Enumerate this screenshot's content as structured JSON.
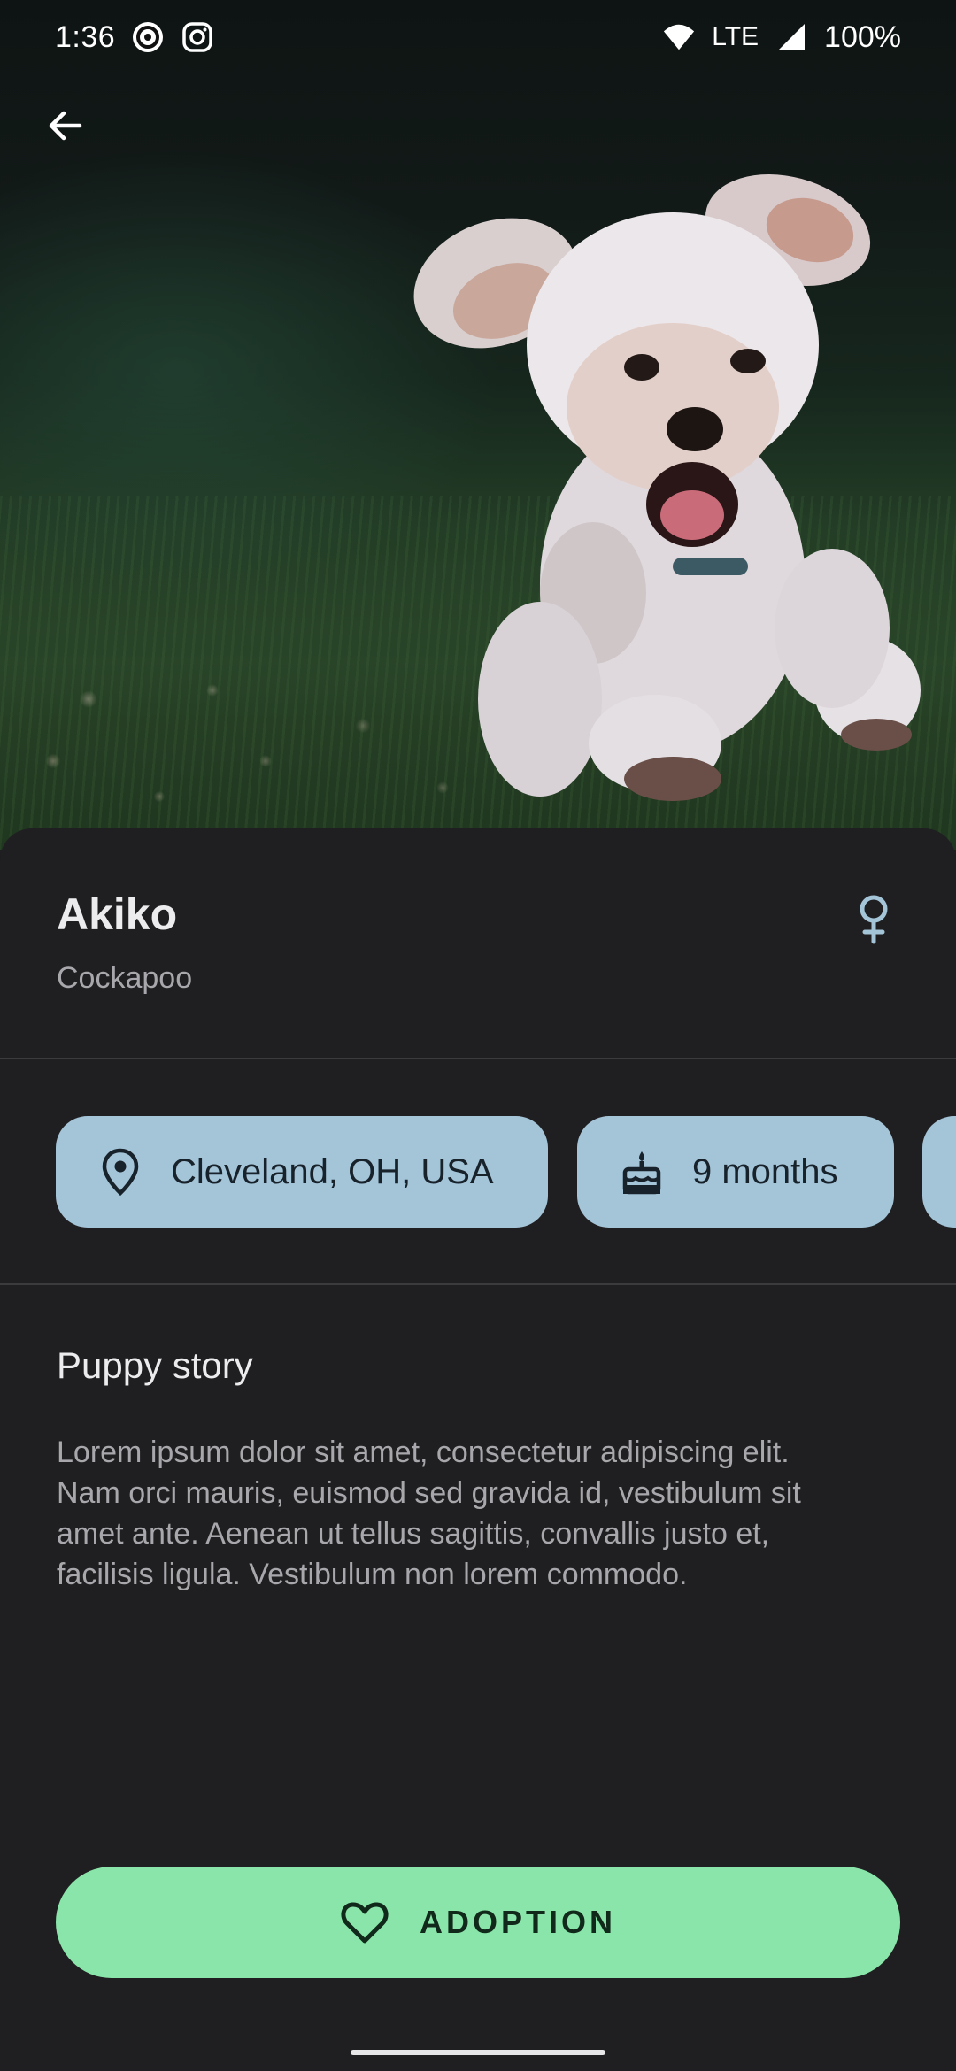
{
  "status_bar": {
    "time": "1:36",
    "network": "LTE",
    "battery": "100%",
    "icons": [
      "sync-circle-icon",
      "instagram-icon",
      "wifi-icon",
      "signal-icon"
    ]
  },
  "hero": {
    "back_icon": "arrow-left-icon",
    "photo": "white-fluffy-dog-running-on-grass"
  },
  "pet": {
    "name": "Akiko",
    "breed": "Cockapoo",
    "gender_icon": "female-icon"
  },
  "chips": [
    {
      "icon": "location-pin-icon",
      "label": "Cleveland, OH, USA"
    },
    {
      "icon": "cake-icon",
      "label": "9 months"
    },
    {
      "icon": "",
      "label": ""
    }
  ],
  "story": {
    "title": "Puppy story",
    "text_lines": [
      "Lorem ipsum dolor sit amet, consectetur adipiscing elit.",
      "Nam orci mauris, euismod sed gravida id, vestibulum sit",
      "amet ante. Aenean ut tellus sagittis, convallis justo et,",
      "facilisis ligula. Vestibulum non lorem commodo."
    ]
  },
  "adopt_button": {
    "icon": "heart-outline-icon",
    "label": "ADOPTION"
  },
  "colors": {
    "background": "#1f1f21",
    "chip": "#a4c4d8",
    "adopt_button": "#89e5a9",
    "gender_icon": "#a4c4d8"
  }
}
